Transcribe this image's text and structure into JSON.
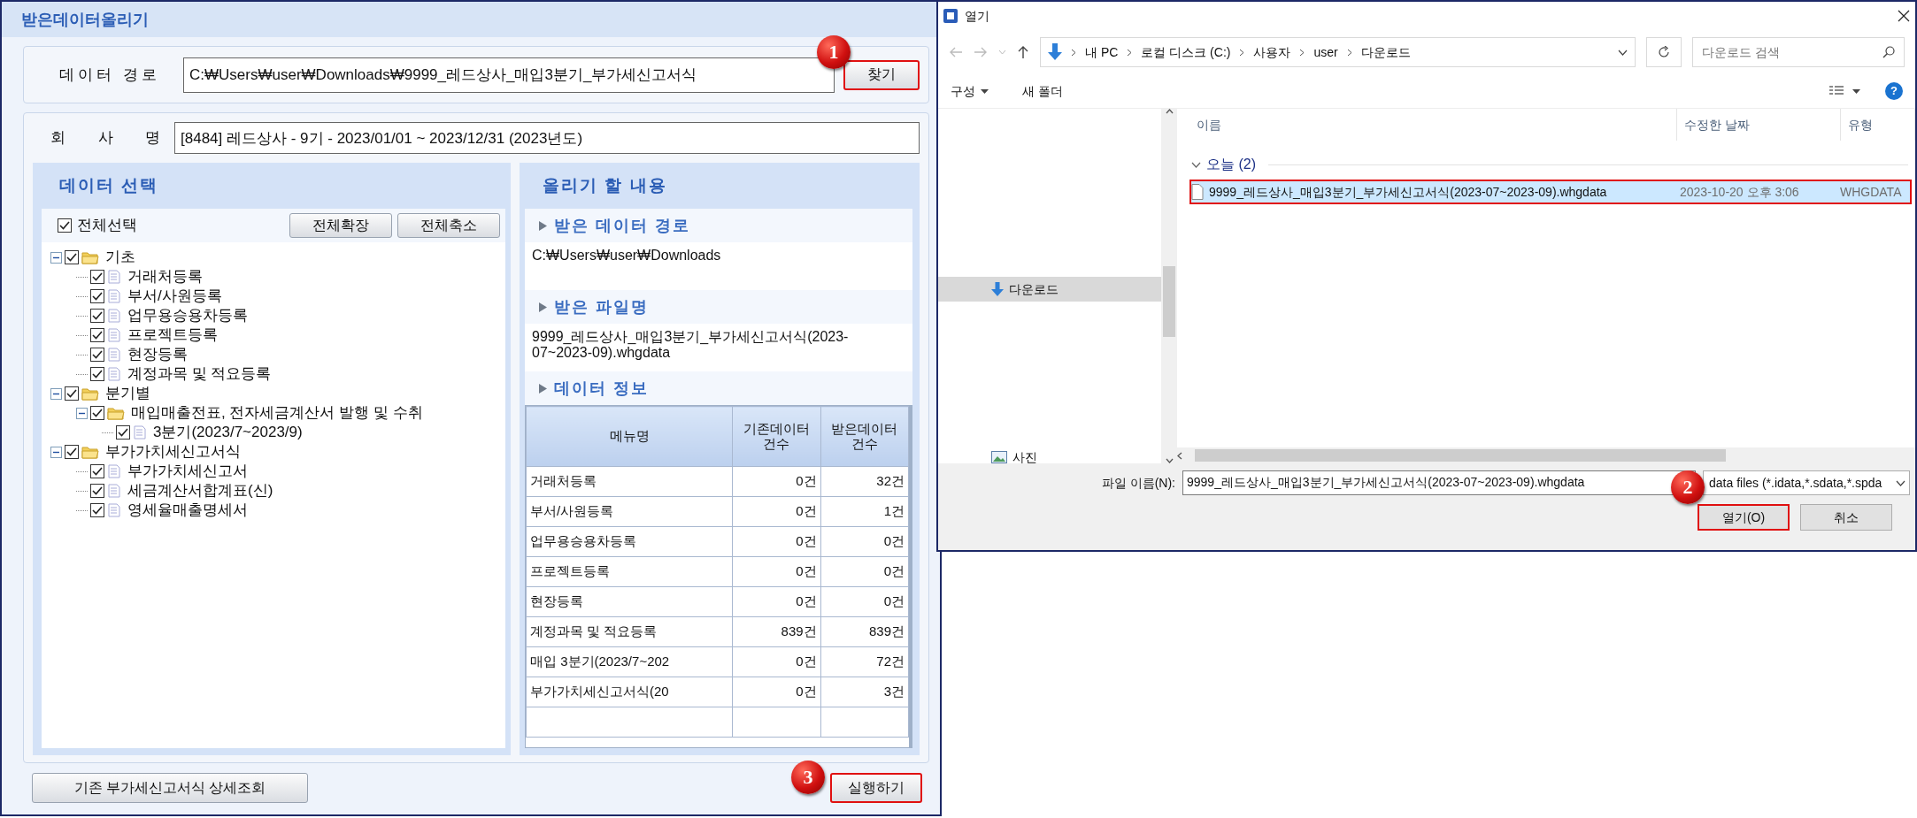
{
  "upload_dialog": {
    "title": "받은데이터올리기",
    "path": {
      "label": "데이터 경로",
      "value": "C:₩Users₩user₩Downloads₩9999_레드상사_매입3분기_부가세신고서식",
      "button": {
        "label": "찾기",
        "highlighted": true,
        "step": "1"
      }
    },
    "company": {
      "label": "회 사 명",
      "value": "[8484] 레드상사 - 9기 - 2023/01/01 ~ 2023/12/31 (2023년도)"
    },
    "data_select": {
      "title": "데이터 선택",
      "select_all": {
        "label": "전체선택",
        "checked": true
      },
      "buttons": [
        "전체확장",
        "전체축소"
      ],
      "tree": [
        {
          "kind": "folder",
          "label": "기초",
          "checked": true,
          "expanded": true,
          "children": [
            {
              "kind": "item",
              "label": "거래처등록",
              "checked": true
            },
            {
              "kind": "item",
              "label": "부서/사원등록",
              "checked": true
            },
            {
              "kind": "item",
              "label": "업무용승용차등록",
              "checked": true
            },
            {
              "kind": "item",
              "label": "프로젝트등록",
              "checked": true
            },
            {
              "kind": "item",
              "label": "현장등록",
              "checked": true
            },
            {
              "kind": "item",
              "label": "계정과목 및 적요등록",
              "checked": true
            }
          ]
        },
        {
          "kind": "folder",
          "label": "분기별",
          "checked": true,
          "expanded": true,
          "children": [
            {
              "kind": "folder",
              "label": "매입매출전표, 전자세금계산서 발행 및 수취",
              "checked": true,
              "expanded": true,
              "children": [
                {
                  "kind": "item",
                  "label": "3분기(2023/7~2023/9)",
                  "checked": true
                }
              ]
            }
          ]
        },
        {
          "kind": "folder",
          "label": "부가가치세신고서식",
          "checked": true,
          "expanded": true,
          "children": [
            {
              "kind": "item",
              "label": "부가가치세신고서",
              "checked": true
            },
            {
              "kind": "item",
              "label": "세금계산서합계표(신)",
              "checked": true
            },
            {
              "kind": "item",
              "label": "영세율매출명세서",
              "checked": true
            }
          ]
        }
      ]
    },
    "upload_content": {
      "title": "올리기 할 내용",
      "path_heading": "받은 데이터 경로",
      "path_value": "C:₩Users₩user₩Downloads",
      "file_heading": "받은 파일명",
      "file_value": "9999_레드상사_매입3분기_부가세신고서식(2023-07~2023-09).whgdata",
      "info_heading": "데이터 정보",
      "table": {
        "columns": [
          "메뉴명",
          "기존데이터 건수",
          "받은데이터 건수"
        ],
        "rows": [
          [
            "거래처등록",
            "0건",
            "32건"
          ],
          [
            "부서/사원등록",
            "0건",
            "1건"
          ],
          [
            "업무용승용차등록",
            "0건",
            "0건"
          ],
          [
            "프로젝트등록",
            "0건",
            "0건"
          ],
          [
            "현장등록",
            "0건",
            "0건"
          ],
          [
            "계정과목 및 적요등록",
            "839건",
            "839건"
          ],
          [
            "매입 3분기(2023/7~202",
            "0건",
            "72건"
          ],
          [
            "부가가치세신고서식(20",
            "0건",
            "3건"
          ]
        ]
      }
    },
    "detail_button": "기존 부가세신고서식 상세조회",
    "run_button": {
      "label": "실행하기",
      "highlighted": true,
      "step": "3"
    }
  },
  "open_dialog": {
    "title": "열기",
    "breadcrumb": [
      "내 PC",
      "로컬 디스크 (C:)",
      "사용자",
      "user",
      "다운로드"
    ],
    "search_placeholder": "다운로드 검색",
    "toolbar": [
      {
        "label": "구성",
        "menu": true
      },
      {
        "label": "새 폴더",
        "menu": false
      }
    ],
    "help": "?",
    "nav_items": [
      {
        "kind": "download",
        "label": "다운로드",
        "selected": true
      },
      {
        "kind": "picture",
        "label": "사진",
        "selected": false
      }
    ],
    "columns": [
      "이름",
      "수정한 날짜",
      "유형"
    ],
    "group": "오늘 (2)",
    "files": [
      {
        "name": "9999_레드상사_매입3분기_부가세신고서식(2023-07~2023-09).whgdata",
        "modified": "2023-10-20 오후 3:06",
        "type": "WHGDATA",
        "selected": true,
        "highlighted": true
      }
    ],
    "filename_label": "파일 이름(N):",
    "filename_value": "9999_레드상사_매입3분기_부가세신고서식(2023-07~2023-09).whgdata",
    "filter": "data files (*.idata,*.sdata,*.spda",
    "open_button": {
      "label": "열기(O)",
      "highlighted": true,
      "step": "2"
    },
    "cancel_button": "취소"
  }
}
